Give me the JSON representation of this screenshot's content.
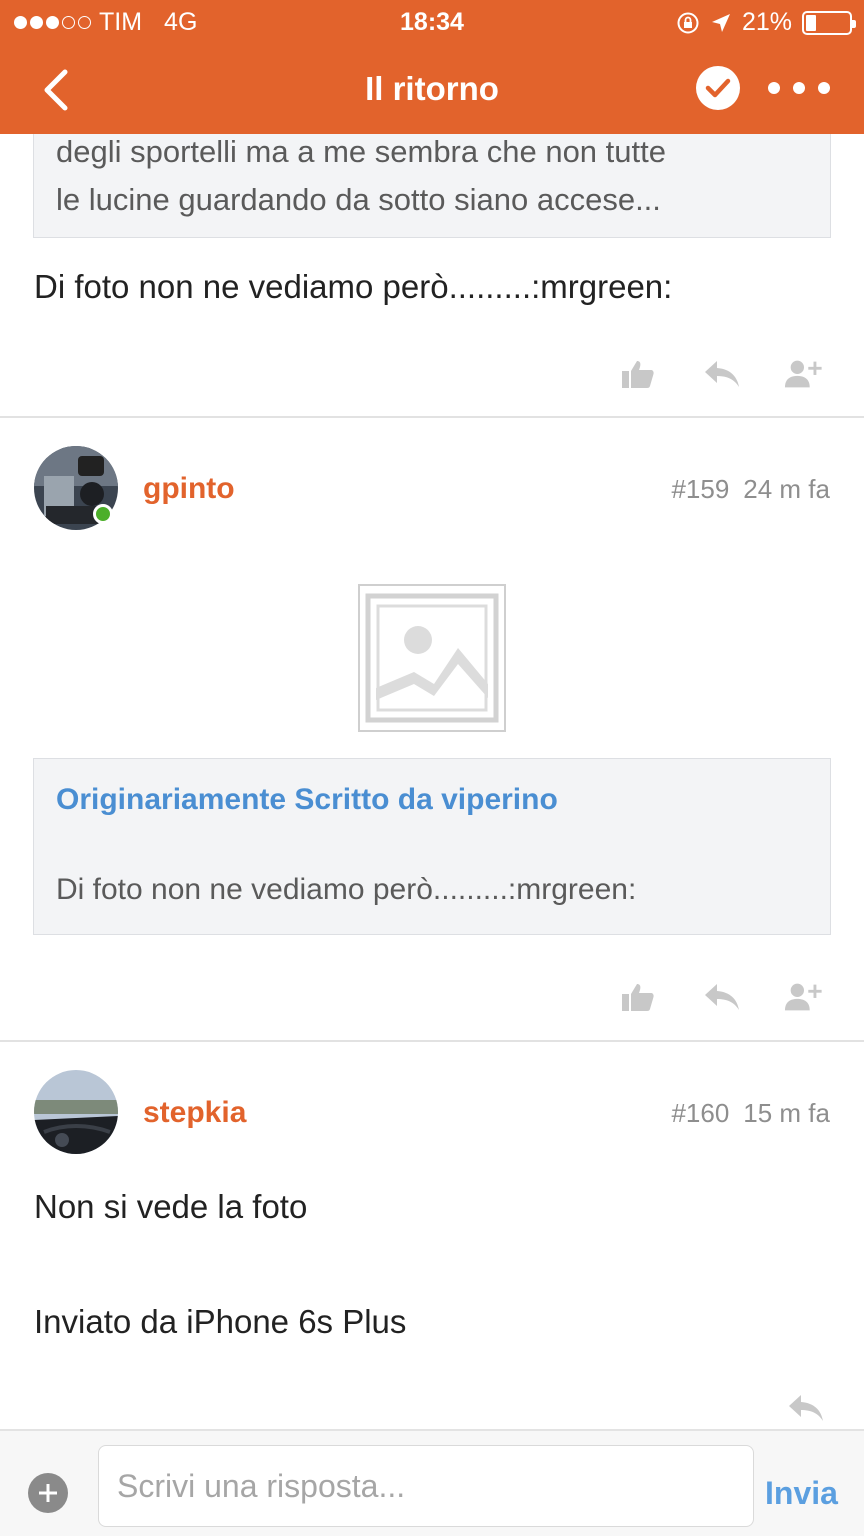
{
  "status_bar": {
    "carrier": "TIM",
    "network": "4G",
    "time": "18:34",
    "battery": "21%",
    "battery_level": 0.21
  },
  "nav": {
    "title": "Il ritorno",
    "back_icon": "chevron-left-icon",
    "check_icon": "check-circle-icon",
    "more_icon": "more-icon"
  },
  "previous_post": {
    "quote_lines": [
      "degli sportelli ma a me sembra che non tutte",
      "le lucine guardando da sotto siano accese..."
    ],
    "text": "Di foto non ne vediamo però.........:mrgreen:"
  },
  "posts": [
    {
      "username": "gpinto",
      "number": "#159",
      "time": "24 m fa",
      "online": true,
      "quote": {
        "author": "Originariamente Scritto da viperino",
        "text": "Di foto non ne vediamo però.........:mrgreen:"
      }
    },
    {
      "username": "stepkia",
      "number": "#160",
      "time": "15 m fa",
      "lines": [
        "Non si vede la foto",
        "Inviato da iPhone 6s Plus"
      ]
    }
  ],
  "reply": {
    "placeholder": "Scrivi una risposta...",
    "send_label": "Invia"
  },
  "colors": {
    "brand": "#E2632C",
    "link": "#4A8ED2",
    "online": "#4CAF2A"
  }
}
